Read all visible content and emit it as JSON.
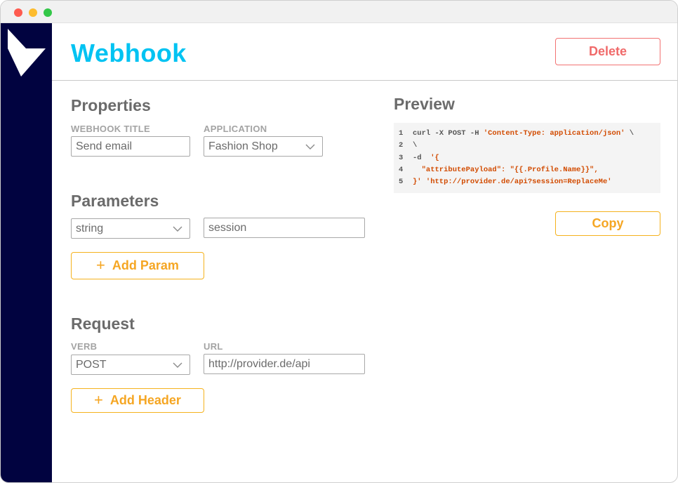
{
  "window": {
    "controls": [
      "close",
      "minimize",
      "maximize"
    ]
  },
  "colors": {
    "sidebar": "#010340",
    "title": "#00c3f2",
    "delete": "#f06a6a",
    "accent": "#f5a623",
    "code_string": "#d24b00"
  },
  "header": {
    "title": "Webhook",
    "delete_label": "Delete"
  },
  "properties": {
    "heading": "Properties",
    "webhook_title_label": "WEBHOOK TITLE",
    "webhook_title_value": "Send email",
    "application_label": "APPLICATION",
    "application_value": "Fashion Shop"
  },
  "parameters": {
    "heading": "Parameters",
    "type_value": "string",
    "name_value": "session",
    "add_label": "Add Param"
  },
  "request": {
    "heading": "Request",
    "verb_label": "VERB",
    "verb_value": "POST",
    "url_label": "URL",
    "url_value": "http://provider.de/api",
    "add_header_label": "Add Header"
  },
  "preview": {
    "heading": "Preview",
    "copy_label": "Copy",
    "lines": [
      {
        "n": "1",
        "plain": "curl -X POST -H ",
        "str": "'Content-Type: application/json'",
        "tail": " \\"
      },
      {
        "n": "2",
        "plain": "\\",
        "str": "",
        "tail": ""
      },
      {
        "n": "3",
        "plain": "-d  ",
        "str": "'{",
        "tail": ""
      },
      {
        "n": "4",
        "plain": "",
        "str": "  \"attributePayload\": \"{{.Profile.Name}}\",",
        "tail": ""
      },
      {
        "n": "5",
        "plain": "",
        "str": "}' 'http://provider.de/api?session=ReplaceMe'",
        "tail": ""
      }
    ]
  }
}
